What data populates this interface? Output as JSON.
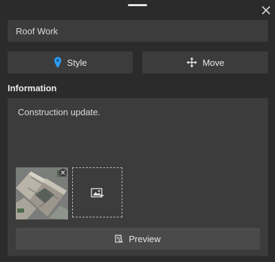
{
  "title_field": {
    "value": "Roof Work"
  },
  "actions": {
    "style_label": "Style",
    "move_label": "Move"
  },
  "information": {
    "heading": "Information",
    "text": "Construction update."
  },
  "preview": {
    "label": "Preview"
  },
  "icons": {
    "close": "close-icon",
    "style": "map-pin-icon",
    "move": "move-arrows-icon",
    "add_image": "add-image-icon",
    "remove_image": "remove-image-icon",
    "preview": "preview-icon"
  },
  "colors": {
    "background": "#2b2b2b",
    "field": "#3c3c3c",
    "preview_button": "#4a4a4a",
    "pin": "#2a9df4"
  }
}
